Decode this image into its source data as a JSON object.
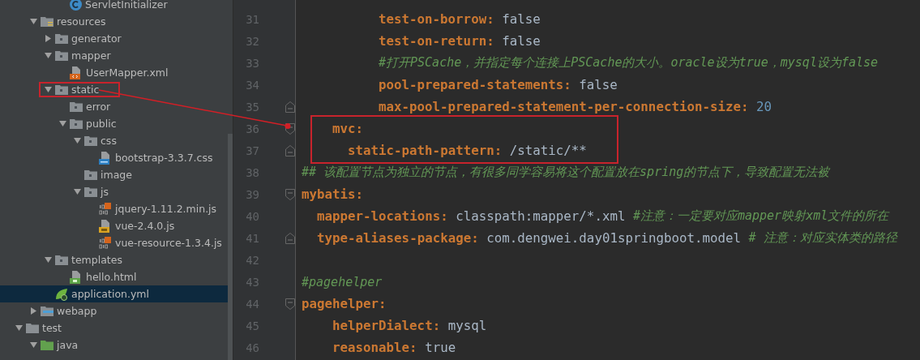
{
  "tree": [
    {
      "children": [
        {
          "children": [
            {
              "children": [
                {
                  "name": "ServletInitializer",
                  "kind": "class",
                  "selected": false
                }
              ]
            }
          ]
        },
        {
          "name": "resources",
          "kind": "resources-folder",
          "expanded": true,
          "selected": false,
          "children": [
            {
              "name": "generator",
              "kind": "folder",
              "expanded": false,
              "selected": false
            },
            {
              "name": "mapper",
              "kind": "folder",
              "expanded": true,
              "selected": false,
              "children": [
                {
                  "name": "UserMapper.xml",
                  "kind": "xml",
                  "selected": false
                }
              ]
            },
            {
              "name": "static",
              "kind": "folder",
              "expanded": true,
              "selected": false,
              "highlighted": true,
              "children": [
                {
                  "name": "error",
                  "kind": "folder",
                  "selected": false
                },
                {
                  "name": "public",
                  "kind": "folder",
                  "expanded": true,
                  "selected": false,
                  "children": [
                    {
                      "name": "css",
                      "kind": "folder",
                      "expanded": true,
                      "selected": false,
                      "children": [
                        {
                          "name": "bootstrap-3.3.7.css",
                          "kind": "css",
                          "selected": false
                        }
                      ]
                    },
                    {
                      "name": "image",
                      "kind": "folder",
                      "selected": false
                    },
                    {
                      "name": "js",
                      "kind": "folder",
                      "expanded": true,
                      "selected": false,
                      "children": [
                        {
                          "name": "jquery-1.11.2.min.js",
                          "kind": "binary",
                          "selected": false
                        },
                        {
                          "name": "vue-2.4.0.js",
                          "kind": "js",
                          "selected": false
                        },
                        {
                          "name": "vue-resource-1.3.4.js",
                          "kind": "binary",
                          "selected": false
                        }
                      ]
                    }
                  ]
                }
              ]
            },
            {
              "name": "templates",
              "kind": "folder",
              "expanded": true,
              "selected": false,
              "children": [
                {
                  "name": "hello.html",
                  "kind": "html",
                  "selected": false
                }
              ]
            },
            {
              "name": "application.yml",
              "kind": "yml",
              "selected": true
            }
          ]
        },
        {
          "name": "webapp",
          "kind": "web-folder",
          "expanded": false,
          "selected": false
        }
      ]
    },
    {
      "name": "test",
      "kind": "test-folder",
      "expanded": true,
      "selected": false,
      "children": [
        {
          "name": "java",
          "kind": "source-folder",
          "expanded": true,
          "selected": false
        }
      ]
    }
  ],
  "lines": [
    {
      "children": [
        {
          "children": [
            {
              "children": [
                {
                  "children": [
                    {
                      "children": [
                        {
                          "number": "31",
                          "segments": [
                            {
                              "kind": "key",
                              "text": "test-on-borrow:"
                            },
                            {
                              "kind": "value",
                              "text": "false"
                            }
                          ]
                        },
                        {
                          "number": "32",
                          "segments": [
                            {
                              "kind": "key",
                              "text": "test-on-return:"
                            },
                            {
                              "kind": "value",
                              "text": "false"
                            }
                          ]
                        },
                        {
                          "number": "33",
                          "segments": [
                            {
                              "kind": "comment",
                              "text": "#打开PSCache，并指定每个连接上PSCache的大小。oracle设为true，mysql设为false"
                            }
                          ]
                        },
                        {
                          "number": "34",
                          "segments": [
                            {
                              "kind": "key",
                              "text": "pool-prepared-statements:"
                            },
                            {
                              "kind": "value",
                              "text": "false"
                            }
                          ]
                        },
                        {
                          "number": "35",
                          "fold_end": true,
                          "segments": [
                            {
                              "kind": "key",
                              "text": "max-pool-prepared-statement-per-connection-size:"
                            },
                            {
                              "kind": "number",
                              "text": "20"
                            }
                          ]
                        }
                      ]
                    }
                  ]
                }
              ]
            },
            {
              "number": "36",
              "highlighted": true,
              "segments": [
                {
                  "kind": "key",
                  "text": "mvc:"
                }
              ],
              "children": [
                {
                  "number": "37",
                  "highlighted": true,
                  "fold_end": true,
                  "segments": [
                    {
                      "kind": "key",
                      "text": "static-path-pattern:"
                    },
                    {
                      "kind": "value",
                      "text": "/static/**"
                    }
                  ]
                }
              ]
            }
          ]
        }
      ]
    },
    {
      "number": "38",
      "segments": [
        {
          "kind": "comment",
          "text": "## 该配置节点为独立的节点，有很多同学容易将这个配置放在spring的节点下，导致配置无法被"
        }
      ]
    },
    {
      "number": "39",
      "segments": [
        {
          "kind": "key",
          "text": "mybatis:"
        }
      ],
      "children": [
        {
          "number": "40",
          "segments": [
            {
              "kind": "key",
              "text": "mapper-locations:"
            },
            {
              "kind": "value",
              "text": "classpath:mapper/*.xml"
            },
            {
              "kind": "comment",
              "text": "#注意：一定要对应mapper映射xml文件的所在"
            }
          ]
        },
        {
          "number": "41",
          "fold_end": true,
          "segments": [
            {
              "kind": "key",
              "text": "type-aliases-package:"
            },
            {
              "kind": "value",
              "text": "com.dengwei.day01springboot.model"
            },
            {
              "kind": "comment",
              "text": "# 注意：对应实体类的路径"
            }
          ]
        }
      ]
    },
    {
      "number": "42"
    },
    {
      "number": "43",
      "segments": [
        {
          "kind": "comment",
          "text": "#pagehelper"
        }
      ]
    },
    {
      "number": "44",
      "segments": [
        {
          "kind": "key",
          "text": "pagehelper:"
        }
      ],
      "children": [
        {
          "children": [
            {
              "number": "45",
              "segments": [
                {
                  "kind": "key",
                  "text": "helperDialect:"
                },
                {
                  "kind": "value",
                  "text": "mysql"
                }
              ]
            },
            {
              "number": "46",
              "segments": [
                {
                  "kind": "key",
                  "text": "reasonable:"
                },
                {
                  "kind": "value",
                  "text": "true"
                }
              ]
            }
          ]
        }
      ]
    }
  ],
  "annotations": {
    "arrow": true
  }
}
